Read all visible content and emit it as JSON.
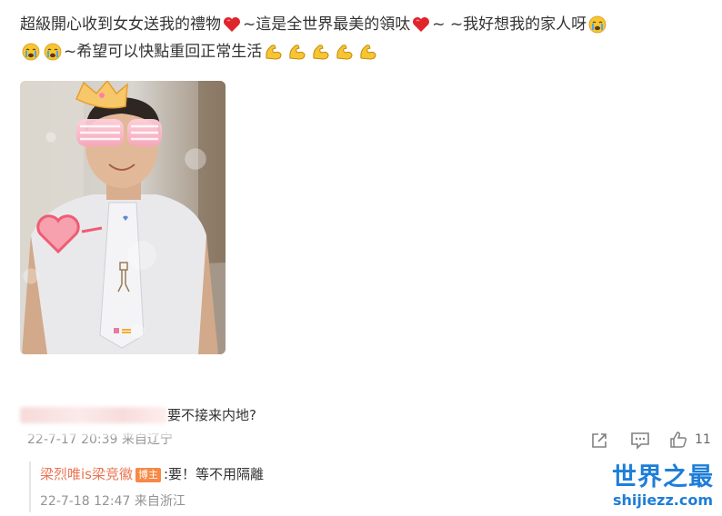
{
  "post": {
    "line1_a": "超級開心收到女女送我的禮物",
    "line1_b": "~這是全世界最美的領呔",
    "line1_c": "~ ~我好想我的家人呀",
    "line2_a": "~希望可以快點重回正常生活"
  },
  "comment": {
    "text": "要不接来内地?",
    "meta": "22-7-17 20:39 来自辽宁",
    "like_count": "11"
  },
  "reply": {
    "author": "梁烈唯is梁竞徽",
    "badge": "博主",
    "text": ":要！等不用隔離",
    "meta": "22-7-18 12:47 来自浙江"
  },
  "watermark": {
    "cn": "世界之最",
    "en": "shijiezz.com"
  },
  "icons": [
    "heart-emoji-icon",
    "crying-emoji-icon",
    "muscle-emoji-icon",
    "share-icon",
    "comment-icon",
    "like-icon"
  ],
  "colors": {
    "author": "#eb7350",
    "badge": "#f78845",
    "meta": "#939393",
    "watermark": "#1e7ed8"
  }
}
